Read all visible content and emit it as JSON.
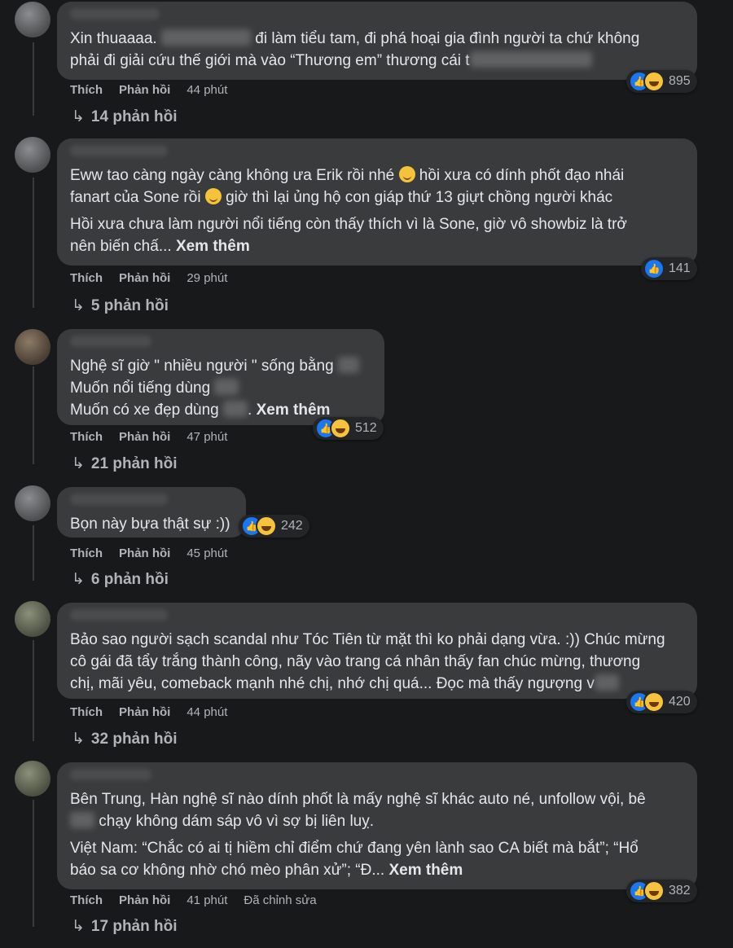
{
  "actions": {
    "like": "Thích",
    "reply": "Phản hồi",
    "edited": "Đã chỉnh sửa"
  },
  "comments": [
    {
      "lines": [
        "Xin thuaaaa.",
        "đi làm tiểu tam, đi phá hoại gia đình người ta chứ không",
        "phải đi giải cứu thế giới mà vào “Thương em” thương cái t"
      ],
      "reaction_count": "895",
      "time": "44 phút",
      "replies": "14 phản hồi"
    },
    {
      "lines": [
        "Eww tao càng ngày càng không ưa Erik rồi nhé",
        "hồi xưa có dính phốt đạo nhái",
        "fanart của Sone rồi",
        "giờ thì lại ủng hộ con giáp thứ 13 giựt chồng người khác",
        "Hồi xưa chưa làm người nổi tiếng còn thấy thích vì là Sone, giờ vô showbiz là trở",
        "nên biến chấ...",
        "Xem thêm"
      ],
      "reaction_count": "141",
      "time": "29 phút",
      "replies": "5 phản hồi"
    },
    {
      "lines": [
        "Nghệ sĩ giờ \" nhiều người \" sống bằng",
        "Muốn nổi tiếng dùng",
        "Muốn có xe đẹp dùng",
        ".",
        "Xem thêm"
      ],
      "reaction_count": "512",
      "time": "47 phút",
      "replies": "21 phản hồi"
    },
    {
      "lines": [
        "Bọn này bựa thật sự :))"
      ],
      "reaction_count": "242",
      "time": "45 phút",
      "replies": "6 phản hồi"
    },
    {
      "lines": [
        "Bảo sao người sạch scandal như Tóc Tiên từ mặt thì ko phải dạng vừa. :)) Chúc mừng",
        "cô gái đã tẩy trắng thành công, nãy vào trang cá nhân thấy fan chúc mừng, thương",
        "chị, mãi yêu, comeback mạnh nhé chị, nhớ chị quá... Đọc mà thấy ngượng v"
      ],
      "reaction_count": "420",
      "time": "44 phút",
      "replies": "32 phản hồi"
    },
    {
      "lines": [
        "Bên Trung, Hàn nghệ sĩ nào dính phốt là mấy nghệ sĩ khác auto né, unfollow vội, bê",
        "chạy không dám sáp vô vì sợ bị liên luỵ.",
        "Việt Nam: “Chắc có ai tị hiềm chỉ điểm chứ đang yên lành sao CA biết mà bắt”; “Hổ",
        "báo sa cơ không nhờ chó mèo phân xử”; “Đ...",
        "Xem thêm"
      ],
      "reaction_count": "382",
      "time": "41 phút",
      "replies": "17 phản hồi"
    }
  ]
}
